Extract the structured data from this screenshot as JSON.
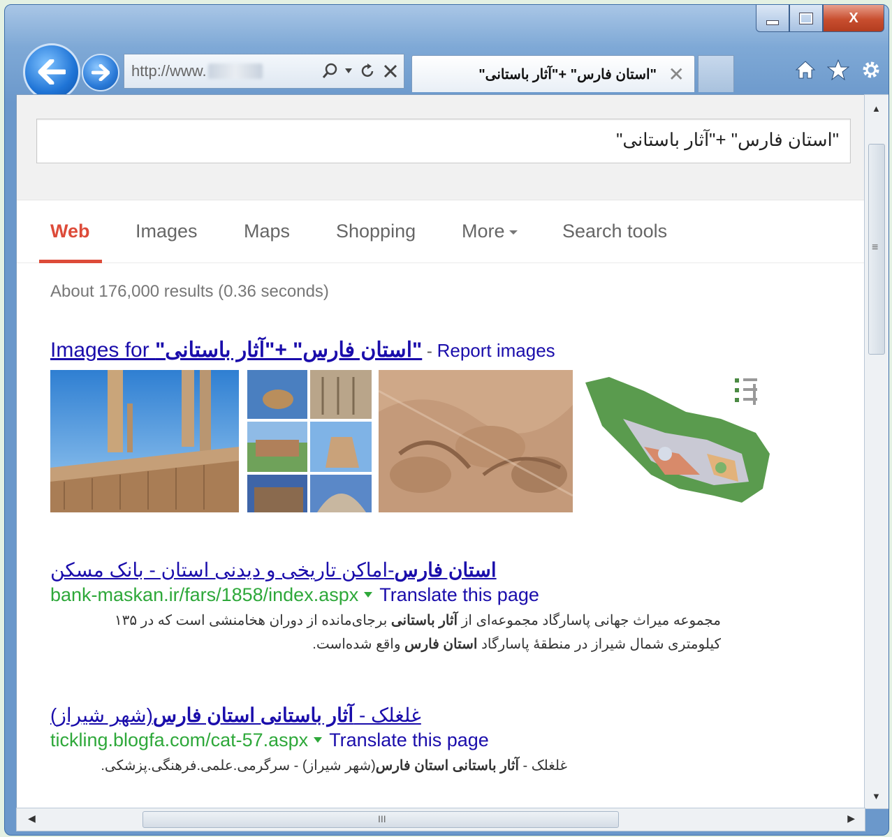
{
  "browser": {
    "address_url": "http://www.",
    "tab_title": "\"استان فارس\" +\"آثار باستانی\"",
    "tab_close": "✕",
    "window_min": "",
    "window_max": "",
    "window_close": "X"
  },
  "search": {
    "query": "\"استان فارس\" +\"آثار باستانی\""
  },
  "nav": {
    "items": [
      "Web",
      "Images",
      "Maps",
      "Shopping",
      "More",
      "Search tools"
    ]
  },
  "stats": "About 176,000 results (0.36 seconds)",
  "images_header": {
    "prefix": "Images for ",
    "query": "\"استان فارس\" +\"آثار باستانی\"",
    "separator": " - ",
    "report": "Report images"
  },
  "results": [
    {
      "title_bold": "استان فارس",
      "title_rest": "-اماکن تاریخی و دیدنی استان - بانک مسکن",
      "url": "bank-maskan.ir/fars/1858/index.aspx",
      "translate": "Translate this page",
      "snippet_1a": "مجموعه میراث جهانی پاسارگاد مجموعه‌ای از ",
      "snippet_1b": "آثار باستانی",
      "snippet_1c": " برجای‌مانده از دوران هخامنشی است که در ۱۳۵",
      "snippet_2a": "کیلومتری شمال شیراز در منطقهٔ پاسارگاد ",
      "snippet_2b": "استان فارس",
      "snippet_2c": " واقع شده‌است."
    },
    {
      "title_a": "غلغلک - ",
      "title_bold": "آثار باستانی استان فارس",
      "title_rest": "(شهر شیراز)",
      "url": "tickling.blogfa.com/cat-57.aspx",
      "translate": "Translate this page",
      "snippet_a": "غلغلک - ",
      "snippet_bold": "آثار باستانی استان فارس",
      "snippet_rest": "(شهر شیراز) - سرگرمی.علمی.فرهنگی.پزشکی."
    }
  ],
  "scroll": {
    "grip": "≡",
    "hgrip": "III"
  },
  "colors": {
    "accent_red": "#dd4b39",
    "link_blue": "#1a0dab",
    "url_green": "#2ea83a"
  }
}
